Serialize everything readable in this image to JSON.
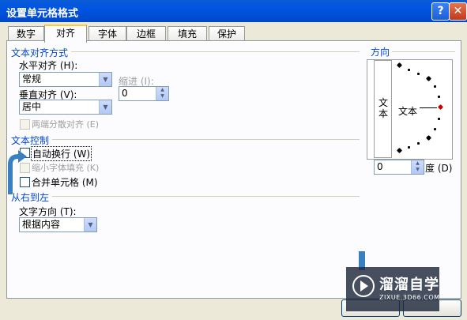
{
  "window": {
    "title": "设置单元格格式",
    "help_symbol": "?",
    "close_symbol": "✕"
  },
  "tabs": [
    "数字",
    "对齐",
    "字体",
    "边框",
    "填充",
    "保护"
  ],
  "active_tab": "对齐",
  "alignment": {
    "section_title": "文本对齐方式",
    "horizontal_label": "水平对齐 (H):",
    "horizontal_value": "常规",
    "indent_label": "缩进 (I):",
    "indent_value": "0",
    "vertical_label": "垂直对齐 (V):",
    "vertical_value": "居中",
    "distributed_label": "两端分散对齐 (E)"
  },
  "text_control": {
    "section_title": "文本控制",
    "wrap_label": "自动换行 (W)",
    "shrink_label": "缩小字体填充 (K)",
    "merge_label": "合并单元格 (M)"
  },
  "rtl": {
    "section_title": "从右到左",
    "direction_label": "文字方向 (T):",
    "direction_value": "根据内容"
  },
  "orientation": {
    "section_title": "方向",
    "vertical_text": "文本",
    "horizontal_text": "文本",
    "degrees_value": "0",
    "degrees_label": "度 (D)"
  },
  "watermark": {
    "line1": "溜溜自学",
    "line2": "ZIXUE.3D66.COM"
  },
  "colors": {
    "group_label": "#0046d5",
    "titlebar": "#0054e3",
    "annotation_arrow": "#3a7fbf"
  }
}
